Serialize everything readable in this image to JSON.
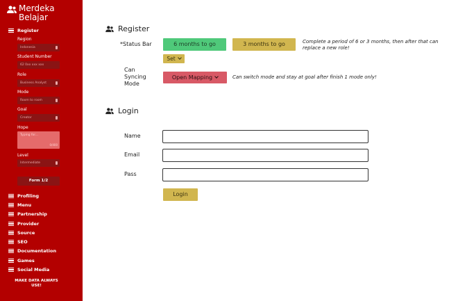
{
  "sidebar": {
    "brand": "Merdeka Belajar",
    "section": "Register",
    "fields": {
      "region": {
        "label": "Region",
        "value": "Indonesia"
      },
      "student_number": {
        "label": "Student Number",
        "placeholder": "62 0xx xxx xxx"
      },
      "role": {
        "label": "Role",
        "value": "Business Analyst"
      },
      "mode": {
        "label": "Mode",
        "value": "Room to room"
      },
      "goal": {
        "label": "Goal",
        "value": "Creator"
      },
      "hope": {
        "label": "Hope",
        "placeholder": "Typing for...",
        "counter": "0/400"
      },
      "level": {
        "label": "Level",
        "value": "Intermediate"
      }
    },
    "form_button": "Form 1/2",
    "menu": [
      "Profiling",
      "Menu",
      "Partnership",
      "Provider",
      "Source",
      "SEO",
      "Documentation",
      "Games",
      "Social Media"
    ],
    "tagline": "MAKE DATA ALWAYS USE!"
  },
  "register": {
    "heading": "Register",
    "status_bar_label": "*Status Bar",
    "btn_6": "6 months to go",
    "btn_3": "3 months to go",
    "set_label": "Set",
    "status_note": "Complete a period of 6 or 3 months, then after that can replace a new role!",
    "syncing_label": "Can Syncing Mode",
    "open_mapping": "Open Mapping",
    "syncing_note": "Can switch mode and stay at goal after finish 1 mode only!"
  },
  "login": {
    "heading": "Login",
    "name_label": "Name",
    "email_label": "Email",
    "pass_label": "Pass",
    "button": "Login"
  },
  "colors": {
    "sidebar_bg": "#b30000",
    "green": "#4fc97a",
    "gold": "#d1b64f",
    "rose": "#d85966"
  }
}
